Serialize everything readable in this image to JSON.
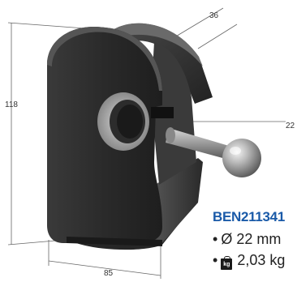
{
  "product": {
    "code": "BEN211341",
    "diameter_text": "Ø 22 mm",
    "weight_text": "2,03 kg",
    "weight_icon": "weight-kg-icon",
    "accent_color": "#1a5aa8"
  },
  "dimensions": {
    "width": "85",
    "height": "118",
    "depth": "36",
    "ball_diameter": "22"
  }
}
